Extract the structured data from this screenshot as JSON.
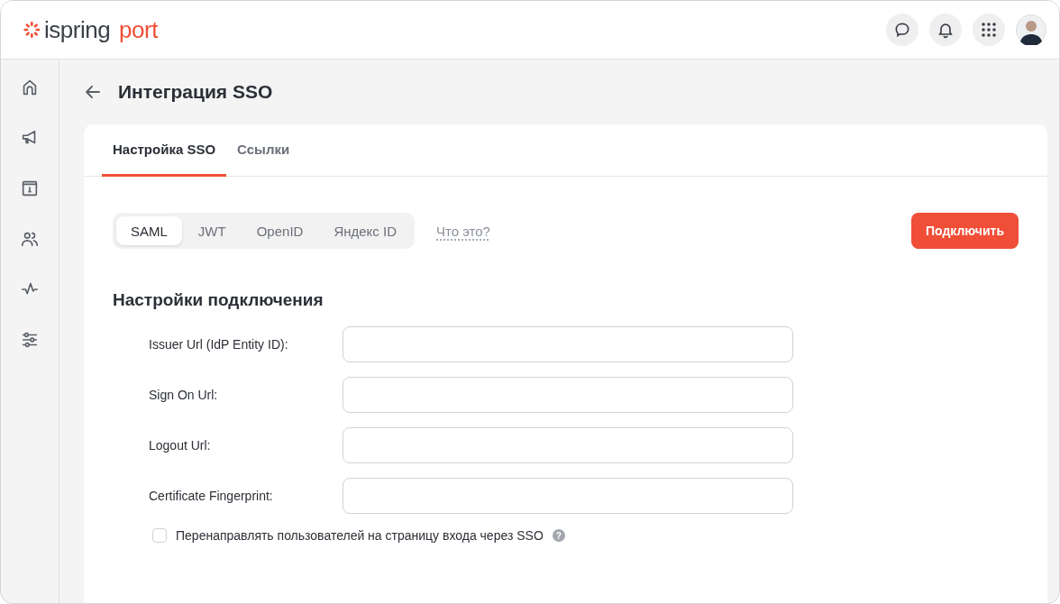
{
  "logo": {
    "brand": "ispring",
    "product": "port"
  },
  "page": {
    "title": "Интеграция SSO"
  },
  "tabs": [
    {
      "label": "Настройка SSO",
      "selected": true
    },
    {
      "label": "Ссылки",
      "selected": false
    }
  ],
  "protocols": [
    {
      "label": "SAML",
      "selected": true
    },
    {
      "label": "JWT",
      "selected": false
    },
    {
      "label": "OpenID",
      "selected": false
    },
    {
      "label": "Яндекс ID",
      "selected": false
    }
  ],
  "help_link": "Что это?",
  "connect_button": "Подключить",
  "section_title": "Настройки подключения",
  "fields": [
    {
      "label": "Issuer Url (IdP Entity ID):"
    },
    {
      "label": "Sign On Url:"
    },
    {
      "label": "Logout Url:"
    },
    {
      "label": "Certificate Fingerprint:"
    }
  ],
  "redirect_option": {
    "label": "Перенаправлять пользователей на страницу входа через SSO",
    "checked": false,
    "help": "?"
  }
}
